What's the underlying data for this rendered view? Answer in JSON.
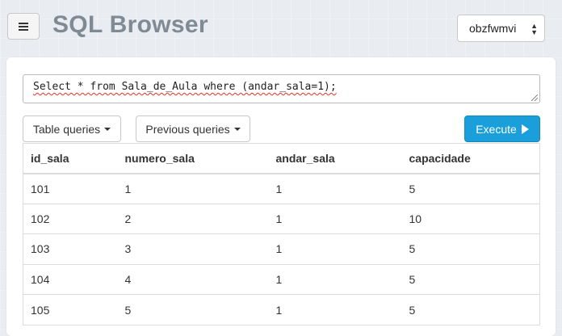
{
  "header": {
    "title": "SQL Browser",
    "db_select": "obzfwmvi"
  },
  "query": {
    "text": "Select * from Sala_de_Aula where (andar_sala=1);"
  },
  "toolbar": {
    "table_queries_label": "Table queries",
    "previous_queries_label": "Previous queries",
    "execute_label": "Execute"
  },
  "results": {
    "columns": [
      "id_sala",
      "numero_sala",
      "andar_sala",
      "capacidade"
    ],
    "rows": [
      [
        "101",
        "1",
        "1",
        "5"
      ],
      [
        "102",
        "2",
        "1",
        "10"
      ],
      [
        "103",
        "3",
        "1",
        "5"
      ],
      [
        "104",
        "4",
        "1",
        "5"
      ],
      [
        "105",
        "5",
        "1",
        "5"
      ]
    ]
  },
  "colors": {
    "accent": "#1a9fdb",
    "title": "#808a95",
    "background": "#e9edf1"
  }
}
